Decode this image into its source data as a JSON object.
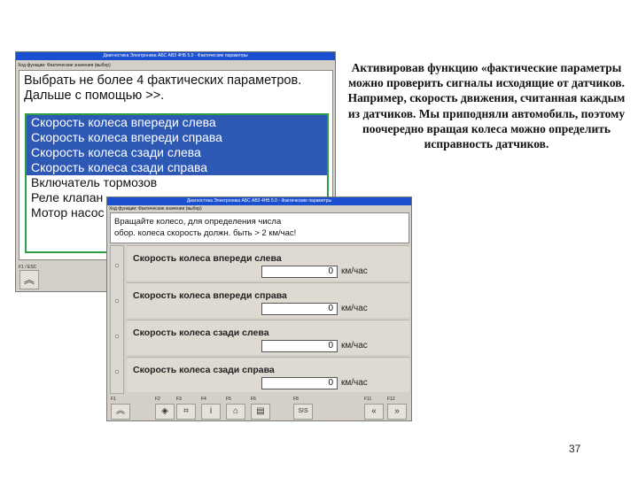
{
  "window_back": {
    "title": "Диагностика Электроника АБС АВЗ 4НБ 5.0 - Фактические параметры",
    "subtitle": "Ход функции: Фактические значения (выбор)",
    "instruction_line1": "Выбрать не более 4 фактических параметров.",
    "instruction_line2": "Дальше с помощью >>.",
    "items": [
      {
        "label": "Скорость колеса впереди слева",
        "selected": true
      },
      {
        "label": "Скорость колеса впереди справа",
        "selected": true
      },
      {
        "label": "Скорость колеса сзади слева",
        "selected": true
      },
      {
        "label": "Скорость колеса сзади справа",
        "selected": true
      },
      {
        "label": "Включатель тормозов",
        "selected": false
      },
      {
        "label": "Реле клапан",
        "selected": false
      },
      {
        "label": "Мотор насос",
        "selected": false
      }
    ],
    "footer_label": "F1 / ESC",
    "footer_button": "︽"
  },
  "window_front": {
    "title": "Диагностика Электроника АБС АВЗ 4НБ 5.0 - Фактические параметры",
    "subtitle": "Ход функции: Фактические значения (выбор)",
    "message_line1": "Вращайте колесо, для определения числа",
    "message_line2": "обор. колеса скорость должн. быть > 2 км/час!",
    "fields": [
      {
        "label": "Скорость колеса впереди слева",
        "value": "0",
        "unit": "км/час"
      },
      {
        "label": "Скорость колеса впереди справа",
        "value": "0",
        "unit": "км/час"
      },
      {
        "label": "Скорость колеса сзади слева",
        "value": "0",
        "unit": "км/час"
      },
      {
        "label": "Скорость колеса сзади справа",
        "value": "0",
        "unit": "км/час"
      }
    ],
    "footer_keys": [
      {
        "key": "F1",
        "glyph": "︽"
      },
      {
        "key": "F2",
        "glyph": "◈"
      },
      {
        "key": "F3",
        "glyph": "⌗"
      },
      {
        "key": "F4",
        "glyph": "i"
      },
      {
        "key": "F5",
        "glyph": "⌂"
      },
      {
        "key": "F6",
        "glyph": "▤"
      },
      {
        "key": "F8",
        "glyph": "SIS"
      },
      {
        "key": "F11",
        "glyph": "«"
      },
      {
        "key": "F12",
        "glyph": "»"
      }
    ]
  },
  "slide": {
    "description": "Активировав функцию «фактические параметры можно проверить сигналы исходящие от датчиков. Например, скорость движения, считанная каждым из датчиков. Мы приподняли автомобиль, поэтому поочередно вращая колеса можно определить исправность датчиков.",
    "page_number": "37"
  },
  "colors": {
    "title_bar": "#1a4fcf",
    "selection": "#2d59b5",
    "list_border": "#2e9e45",
    "window_bg": "#d4d0c8"
  }
}
